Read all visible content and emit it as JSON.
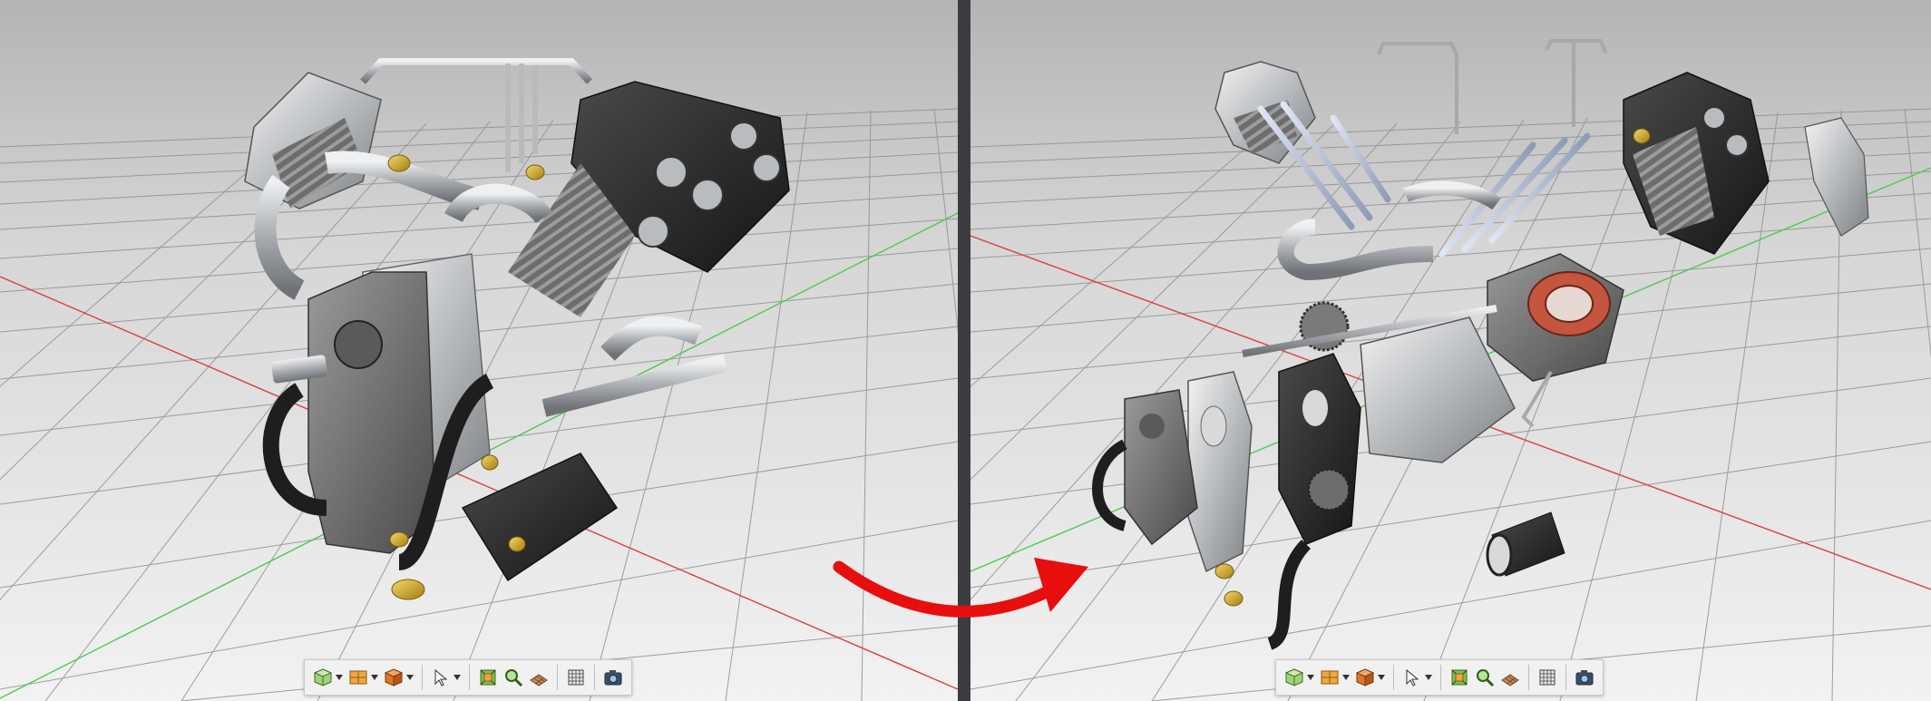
{
  "views": [
    {
      "id": "assembled",
      "toolbar": {
        "buttons": [
          {
            "name": "view-cube-button",
            "icon": "view-cube-icon",
            "dropdown": true
          },
          {
            "name": "display-mode-button",
            "icon": "display-mode-icon",
            "dropdown": true
          },
          {
            "name": "shaded-cube-button",
            "icon": "shaded-cube-icon",
            "dropdown": true
          },
          {
            "name": "select-cursor-button",
            "icon": "cursor-icon",
            "dropdown": true
          },
          {
            "name": "fit-all-button",
            "icon": "fit-all-icon",
            "dropdown": false
          },
          {
            "name": "zoom-to-selection-button",
            "icon": "zoom-icon",
            "dropdown": false
          },
          {
            "name": "ground-plane-button",
            "icon": "ground-plane-icon",
            "dropdown": false
          },
          {
            "name": "grid-toggle-button",
            "icon": "grid-icon",
            "dropdown": false
          },
          {
            "name": "screenshot-button",
            "icon": "camera-icon",
            "dropdown": false
          }
        ]
      }
    },
    {
      "id": "exploded",
      "toolbar": {
        "buttons": [
          {
            "name": "view-cube-button",
            "icon": "view-cube-icon",
            "dropdown": true
          },
          {
            "name": "display-mode-button",
            "icon": "display-mode-icon",
            "dropdown": true
          },
          {
            "name": "shaded-cube-button",
            "icon": "shaded-cube-icon",
            "dropdown": true
          },
          {
            "name": "select-cursor-button",
            "icon": "cursor-icon",
            "dropdown": true
          },
          {
            "name": "fit-all-button",
            "icon": "fit-all-icon",
            "dropdown": false
          },
          {
            "name": "zoom-to-selection-button",
            "icon": "zoom-icon",
            "dropdown": false
          },
          {
            "name": "ground-plane-button",
            "icon": "ground-plane-icon",
            "dropdown": false
          },
          {
            "name": "grid-toggle-button",
            "icon": "grid-icon",
            "dropdown": false
          },
          {
            "name": "screenshot-button",
            "icon": "camera-icon",
            "dropdown": false
          }
        ]
      }
    }
  ],
  "colors": {
    "background_top": "#b9b9b9",
    "background_bottom": "#f1f1f1",
    "grid_line": "#8f8f8f",
    "x_axis": "#e23b3b",
    "y_axis": "#4ec94e",
    "arrow": "#e80e0e",
    "divider": "#3c3d40",
    "metal": "#c9cbcd",
    "dark_part": "#2a2a2a",
    "gasket": "#c4553f",
    "brass": "#c9a227"
  }
}
